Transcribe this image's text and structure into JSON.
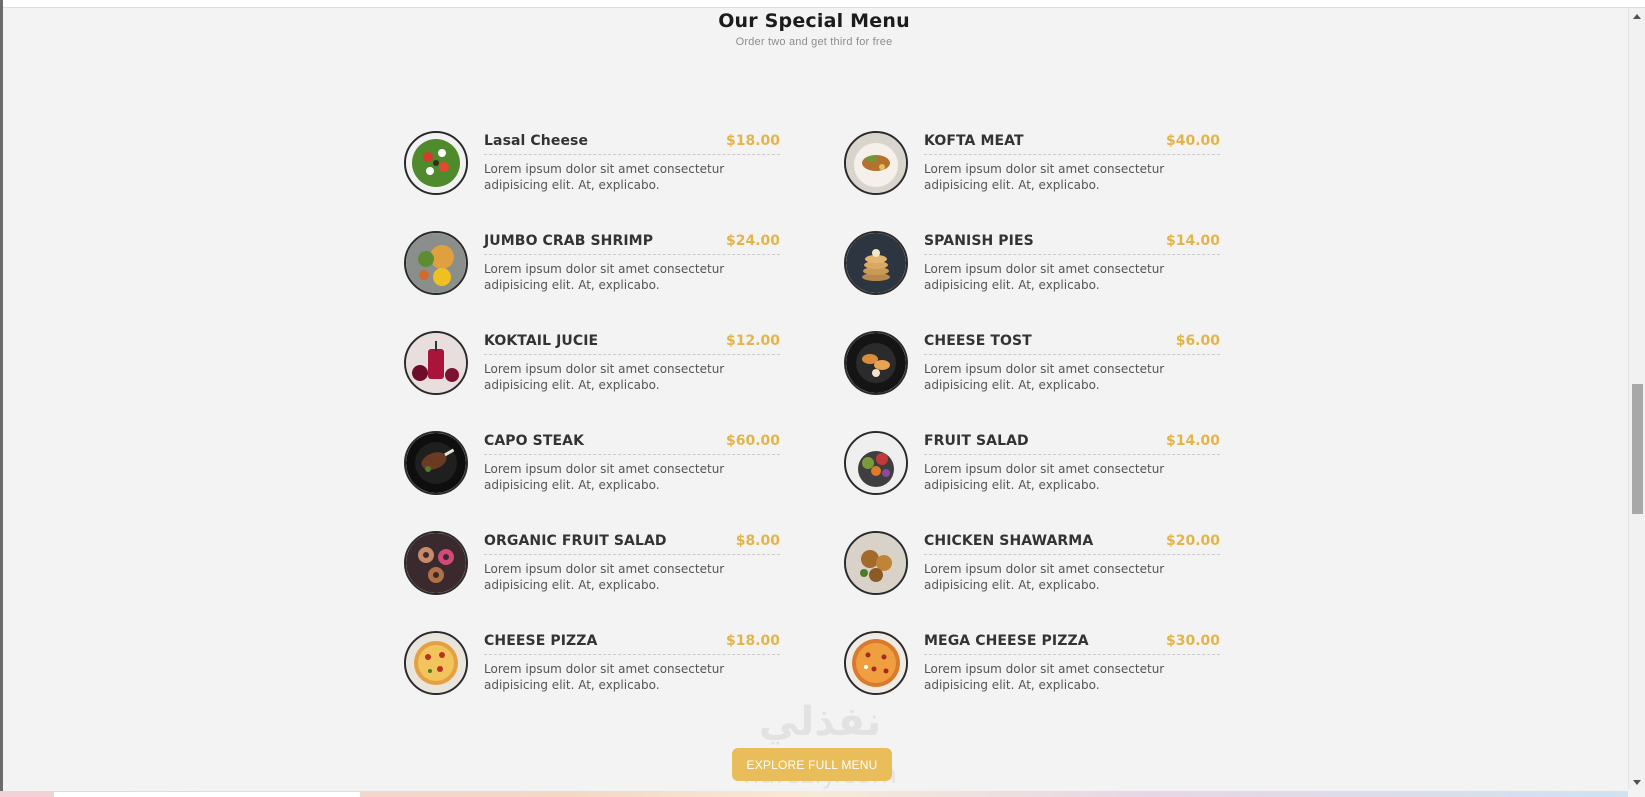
{
  "header": {
    "title": "Our Special Menu",
    "subtitle": "Order two and get third for free"
  },
  "menu": {
    "items": [
      {
        "name": "Lasal Cheese",
        "price": "$18.00",
        "desc": "Lorem ipsum dolor sit amet consectetur adipisicing elit. At, explicabo.",
        "image": "salad-image"
      },
      {
        "name": "KOFTA MEAT",
        "price": "$40.00",
        "desc": "Lorem ipsum dolor sit amet consectetur adipisicing elit. At, explicabo.",
        "image": "meat-plate-image"
      },
      {
        "name": "JUMBO CRAB SHRIMP",
        "price": "$24.00",
        "desc": "Lorem ipsum dolor sit amet consectetur adipisicing elit. At, explicabo.",
        "image": "shrimp-image"
      },
      {
        "name": "SPANISH PIES",
        "price": "$14.00",
        "desc": "Lorem ipsum dolor sit amet consectetur adipisicing elit. At, explicabo.",
        "image": "pancakes-image"
      },
      {
        "name": "KOKTAIL JUCIE",
        "price": "$12.00",
        "desc": "Lorem ipsum dolor sit amet consectetur adipisicing elit. At, explicabo.",
        "image": "juice-image"
      },
      {
        "name": "CHEESE TOST",
        "price": "$6.00",
        "desc": "Lorem ipsum dolor sit amet consectetur adipisicing elit. At, explicabo.",
        "image": "toast-image"
      },
      {
        "name": "CAPO STEAK",
        "price": "$60.00",
        "desc": "Lorem ipsum dolor sit amet consectetur adipisicing elit. At, explicabo.",
        "image": "steak-image"
      },
      {
        "name": "FRUIT SALAD",
        "price": "$14.00",
        "desc": "Lorem ipsum dolor sit amet consectetur adipisicing elit. At, explicabo.",
        "image": "fruit-bowl-image"
      },
      {
        "name": "ORGANIC FRUIT SALAD",
        "price": "$8.00",
        "desc": "Lorem ipsum dolor sit amet consectetur adipisicing elit. At, explicabo.",
        "image": "donuts-image"
      },
      {
        "name": "CHICKEN SHAWARMA",
        "price": "$20.00",
        "desc": "Lorem ipsum dolor sit amet consectetur adipisicing elit. At, explicabo.",
        "image": "chicken-image"
      },
      {
        "name": "CHEESE PIZZA",
        "price": "$18.00",
        "desc": "Lorem ipsum dolor sit amet consectetur adipisicing elit. At, explicabo.",
        "image": "pizza-image"
      },
      {
        "name": "MEGA CHEESE PIZZA",
        "price": "$30.00",
        "desc": "Lorem ipsum dolor sit amet consectetur adipisicing elit. At, explicabo.",
        "image": "pizza-image"
      }
    ]
  },
  "cta": {
    "label": "EXPLORE FULL MENU"
  },
  "colors": {
    "accent": "#e2b54a",
    "button": "#e9bd59",
    "background": "#f4f3f3"
  }
}
